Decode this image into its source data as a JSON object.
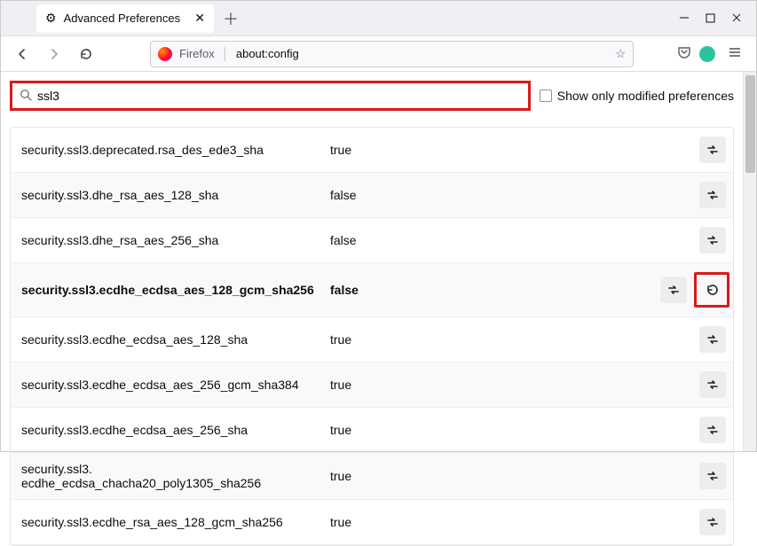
{
  "tab": {
    "title": "Advanced Preferences"
  },
  "urlbar": {
    "brand": "Firefox",
    "url": "about:config"
  },
  "search": {
    "value": "ssl3",
    "checkbox_label": "Show only modified preferences"
  },
  "prefs": [
    {
      "name": "security.ssl3.deprecated.rsa_des_ede3_sha",
      "value": "true",
      "modified": false
    },
    {
      "name": "security.ssl3.dhe_rsa_aes_128_sha",
      "value": "false",
      "modified": false
    },
    {
      "name": "security.ssl3.dhe_rsa_aes_256_sha",
      "value": "false",
      "modified": false
    },
    {
      "name": "security.ssl3.ecdhe_ecdsa_aes_128_gcm_sha256",
      "value": "false",
      "modified": true
    },
    {
      "name": "security.ssl3.ecdhe_ecdsa_aes_128_sha",
      "value": "true",
      "modified": false
    },
    {
      "name": "security.ssl3.ecdhe_ecdsa_aes_256_gcm_sha384",
      "value": "true",
      "modified": false
    },
    {
      "name": "security.ssl3.ecdhe_ecdsa_aes_256_sha",
      "value": "true",
      "modified": false
    },
    {
      "name": "security.ssl3.ecdhe_ecdsa_chacha20_poly1305_sha256",
      "value": "true",
      "modified": false
    },
    {
      "name": "security.ssl3.ecdhe_rsa_aes_128_gcm_sha256",
      "value": "true",
      "modified": false
    }
  ]
}
